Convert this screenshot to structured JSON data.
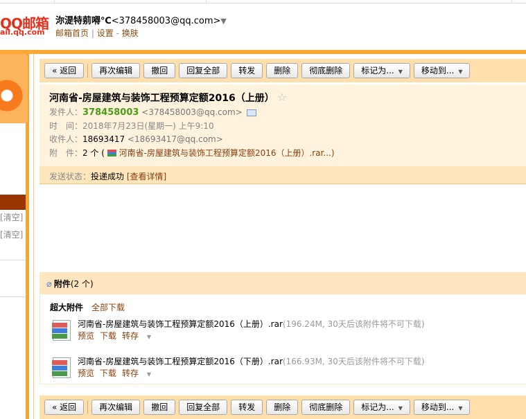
{
  "header": {
    "logo_main": "QQ邮箱",
    "logo_sub": "ail.qq.com",
    "user_name": "沵湜特莂嘚℃",
    "user_email": "<378458003@qq.com>",
    "links": [
      "邮箱首页",
      "设置",
      "换肤"
    ]
  },
  "sidebar": {
    "clear_labels": [
      "[清空]",
      "[清空]"
    ]
  },
  "toolbar": {
    "back": "« 返回",
    "buttons": [
      "再次编辑",
      "撤回",
      "回复全部",
      "转发",
      "删除",
      "彻底删除"
    ],
    "mark": "标记为...",
    "move": "移动到..."
  },
  "mail": {
    "subject": "河南省-房屋建筑与装饰工程预算定额2016（上册）",
    "sender_label": "发件人：",
    "sender_name": "378458003",
    "sender_email": "<378458003@qq.com>",
    "time_label": "时　间：",
    "time": "2018年7月23日(星期一) 上午9:10",
    "to_label": "收件人：",
    "to_name": "18693417",
    "to_email": "<18693417@qq.com>",
    "att_label": "附　件：",
    "att_count": "2 个 (",
    "att_summary": "河南省-房屋建筑与装饰工程预算定额2016（上册）.rar...)",
    "status_label": "发送状态：",
    "status": "投递成功",
    "status_link": "[查看详情]"
  },
  "attachments": {
    "header": "附件",
    "count": "(2 个)",
    "section": "超大附件",
    "download_all": "全部下载",
    "items": [
      {
        "name": "河南省-房屋建筑与装饰工程预算定额2016（上册）.rar",
        "meta": "(196.24M, 30天后该附件将不可下载)",
        "preview": "预览",
        "download": "下载",
        "save": "转存"
      },
      {
        "name": "河南省-房屋建筑与装饰工程预算定额2016（下册）.rar",
        "meta": "(166.93M, 30天后该附件将不可下载)",
        "preview": "预览",
        "download": "下载",
        "save": "转存"
      }
    ]
  }
}
